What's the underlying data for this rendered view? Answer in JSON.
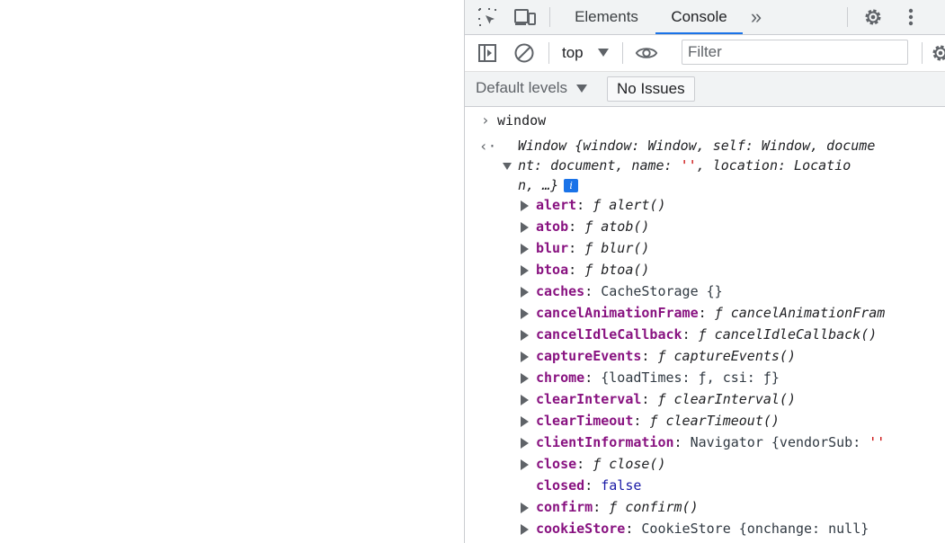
{
  "tabs": {
    "elements": "Elements",
    "console": "Console",
    "more": "»"
  },
  "toolbar": {
    "context": "top",
    "filter_placeholder": "Filter"
  },
  "levels": {
    "default_levels": "Default levels",
    "issues": "No Issues"
  },
  "console": {
    "input": "window",
    "summary_line1": "Window {window: Window, self: Window, docume",
    "summary_line2": "nt: document, name: '', location: Locatio",
    "summary_line3": "n, …}",
    "props": [
      {
        "key": "alert",
        "sep": ": ",
        "val": "ƒ alert()",
        "italic": true,
        "expandable": true
      },
      {
        "key": "atob",
        "sep": ": ",
        "val": "ƒ atob()",
        "italic": true,
        "expandable": true
      },
      {
        "key": "blur",
        "sep": ": ",
        "val": "ƒ blur()",
        "italic": true,
        "expandable": true
      },
      {
        "key": "btoa",
        "sep": ": ",
        "val": "ƒ btoa()",
        "italic": true,
        "expandable": true
      },
      {
        "key": "caches",
        "sep": ": ",
        "val": "CacheStorage {}",
        "italic": false,
        "expandable": true
      },
      {
        "key": "cancelAnimationFrame",
        "sep": ": ",
        "val": "ƒ cancelAnimationFram",
        "italic": true,
        "expandable": true
      },
      {
        "key": "cancelIdleCallback",
        "sep": ": ",
        "val": "ƒ cancelIdleCallback()",
        "italic": true,
        "expandable": true
      },
      {
        "key": "captureEvents",
        "sep": ": ",
        "val": "ƒ captureEvents()",
        "italic": true,
        "expandable": true
      },
      {
        "key": "chrome",
        "sep": ": ",
        "val": "{loadTimes: ƒ, csi: ƒ}",
        "italic": false,
        "expandable": true
      },
      {
        "key": "clearInterval",
        "sep": ": ",
        "val": "ƒ clearInterval()",
        "italic": true,
        "expandable": true
      },
      {
        "key": "clearTimeout",
        "sep": ": ",
        "val": "ƒ clearTimeout()",
        "italic": true,
        "expandable": true
      },
      {
        "key": "clientInformation",
        "sep": ": ",
        "val": "Navigator {vendorSub: ''",
        "italic": false,
        "expandable": true
      },
      {
        "key": "close",
        "sep": ": ",
        "val": "ƒ close()",
        "italic": true,
        "expandable": true
      },
      {
        "key": "closed",
        "sep": ": ",
        "val": "false",
        "italic": false,
        "expandable": false
      },
      {
        "key": "confirm",
        "sep": ": ",
        "val": "ƒ confirm()",
        "italic": true,
        "expandable": true
      },
      {
        "key": "cookieStore",
        "sep": ": ",
        "val": "CookieStore {onchange: null}",
        "italic": false,
        "expandable": true
      }
    ]
  },
  "colors": {
    "accent": "#1a73e8",
    "key": "#881280",
    "string": "#c80000",
    "number_bool": "#1a1aa6"
  }
}
